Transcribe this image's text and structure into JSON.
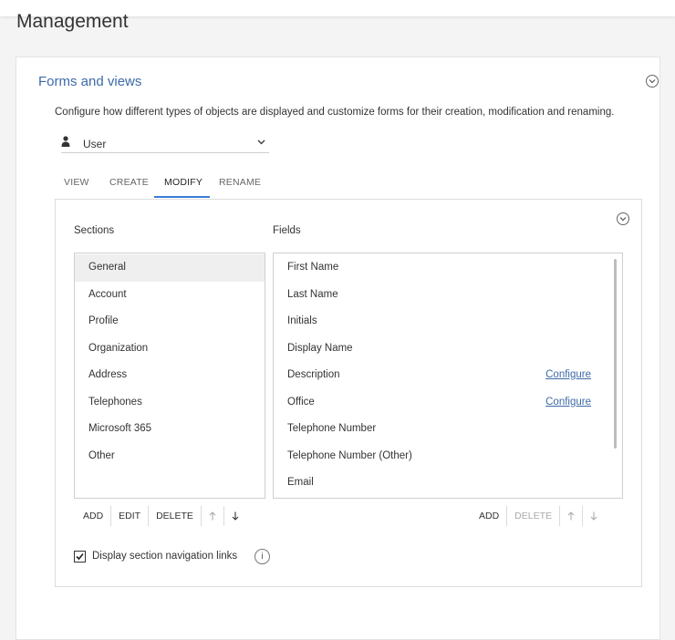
{
  "page": {
    "title": "Management"
  },
  "card": {
    "title": "Forms and views",
    "description": "Configure how different types of objects are displayed and customize forms for their creation, modification and renaming."
  },
  "object_type": {
    "selected": "User"
  },
  "tabs": [
    {
      "label": "VIEW",
      "active": false
    },
    {
      "label": "CREATE",
      "active": false
    },
    {
      "label": "MODIFY",
      "active": true
    },
    {
      "label": "RENAME",
      "active": false
    }
  ],
  "sections": {
    "header": "Sections",
    "items": [
      "General",
      "Account",
      "Profile",
      "Organization",
      "Address",
      "Telephones",
      "Microsoft 365",
      "Other"
    ],
    "selected": "General",
    "buttons": {
      "add": "ADD",
      "edit": "EDIT",
      "delete": "DELETE"
    }
  },
  "fields": {
    "header": "Fields",
    "items": [
      {
        "label": "First Name",
        "action": ""
      },
      {
        "label": "Last Name",
        "action": ""
      },
      {
        "label": "Initials",
        "action": ""
      },
      {
        "label": "Display Name",
        "action": ""
      },
      {
        "label": "Description",
        "action": "Configure"
      },
      {
        "label": "Office",
        "action": "Configure"
      },
      {
        "label": "Telephone Number",
        "action": ""
      },
      {
        "label": "Telephone Number (Other)",
        "action": ""
      },
      {
        "label": "Email",
        "action": ""
      }
    ],
    "buttons": {
      "add": "ADD",
      "delete": "DELETE"
    }
  },
  "nav_links": {
    "label": "Display section navigation links",
    "checked": true,
    "info_symbol": "i"
  },
  "icons": {
    "collapse": "chevron-down-circle-icon",
    "user": "user-icon",
    "dropdown": "chevron-down-icon",
    "up": "arrow-up-icon",
    "down": "arrow-down-icon",
    "check": "check-icon",
    "info": "info-icon"
  },
  "colors": {
    "accent": "#3a7bd5",
    "link": "#3d6aa8",
    "selected_row": "#efefef",
    "disabled": "#aaaaaa"
  }
}
